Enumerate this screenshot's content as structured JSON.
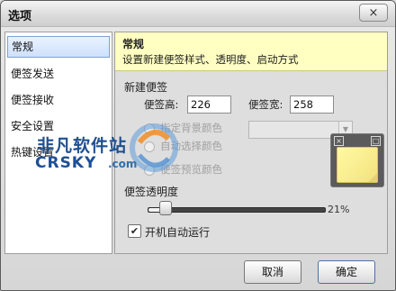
{
  "window": {
    "title": "选项",
    "close_icon": "×"
  },
  "sidebar": {
    "items": [
      {
        "label": "常规",
        "active": true
      },
      {
        "label": "便签发送",
        "active": false
      },
      {
        "label": "便签接收",
        "active": false
      },
      {
        "label": "安全设置",
        "active": false
      },
      {
        "label": "热键设置",
        "active": false
      }
    ]
  },
  "panel": {
    "title": "常规",
    "description": "设置新建便签样式、透明度、启动方式",
    "new_note": {
      "section_label": "新建便签",
      "height_label": "便签高:",
      "height_value": "226",
      "width_label": "便签宽:",
      "width_value": "258",
      "bg_color_label": "指定背景颜色",
      "random_color_label": "自动选择颜色",
      "show_color_label": "便签预览颜色"
    },
    "opacity": {
      "label": "便签透明度",
      "value_text": "21%",
      "value": 0.21
    },
    "autostart": {
      "label": "开机自动运行",
      "checked": true
    }
  },
  "watermark": {
    "cn_text": "非凡软件站",
    "en_text": "CRSKY",
    "domain": ".com"
  },
  "buttons": {
    "cancel": "取消",
    "ok": "确定"
  },
  "colors": {
    "header_bg": "#ffffc2",
    "note_yellow": "#fff9a6",
    "active_item": "#cfe0fb"
  }
}
